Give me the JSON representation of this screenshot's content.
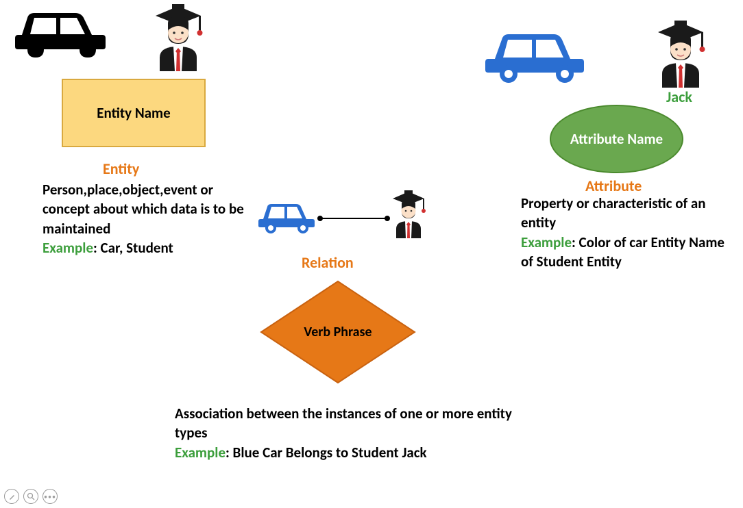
{
  "entity": {
    "shape_label": "Entity Name",
    "title": "Entity",
    "desc": "Person,place,object,event or concept about which data is to be maintained",
    "example_label": "Example",
    "example_text": ": Car, Student"
  },
  "attribute": {
    "shape_label": "Attribute Name",
    "title": "Attribute",
    "person_name": "Jack",
    "desc": "Property or characteristic of an entity",
    "example_label": "Example",
    "example_text": ": Color of car Entity Name of Student Entity"
  },
  "relation": {
    "title": "Relation",
    "shape_label": "Verb Phrase",
    "desc": "Association between the instances of one or more entity types",
    "example_label": "Example",
    "example_text": ": Blue Car Belongs to Student Jack"
  }
}
